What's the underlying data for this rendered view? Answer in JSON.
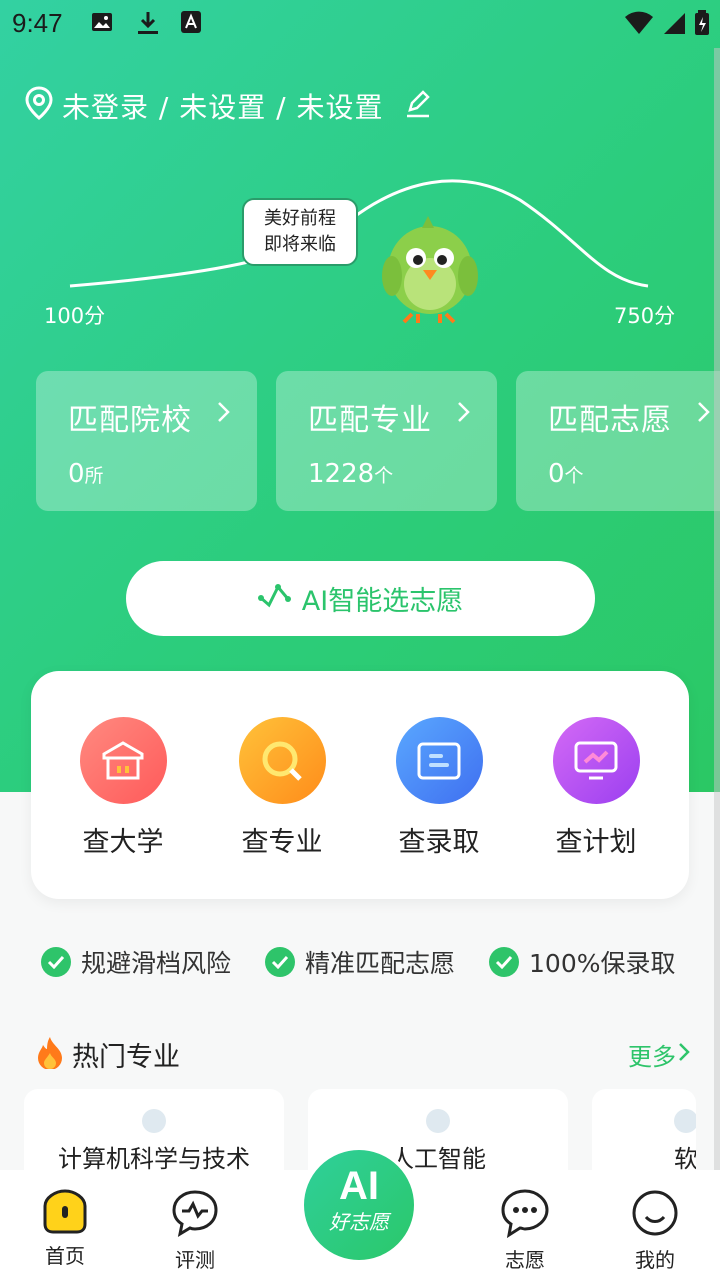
{
  "status_bar": {
    "time": "9:47"
  },
  "location": {
    "text": "未登录 / 未设置 / 未设置"
  },
  "hero": {
    "bubble_line1": "美好前程",
    "bubble_line2": "即将来临",
    "score_min": "100分",
    "score_max": "750分"
  },
  "match_cards": [
    {
      "title": "匹配院校",
      "count": "0",
      "unit": "所"
    },
    {
      "title": "匹配专业",
      "count": "1228",
      "unit": "个"
    },
    {
      "title": "匹配志愿",
      "count": "0",
      "unit": "个"
    }
  ],
  "ai_button": {
    "label": "AI智能选志愿"
  },
  "query_items": [
    {
      "label": "查大学",
      "icon": "university-icon",
      "color": "#ff6e6e"
    },
    {
      "label": "查专业",
      "icon": "search-icon",
      "color": "#ffa726"
    },
    {
      "label": "查录取",
      "icon": "admission-icon",
      "color": "#4f8ef7"
    },
    {
      "label": "查计划",
      "icon": "plan-chart-icon",
      "color": "#b04ff0"
    }
  ],
  "features": [
    "规避滑档风险",
    "精准匹配志愿",
    "100%保录取"
  ],
  "hot_majors": {
    "title": "热门专业",
    "more": "更多",
    "items": [
      "计算机科学与技术",
      "人工智能",
      "软件"
    ]
  },
  "tabbar": {
    "home": "首页",
    "assess": "评测",
    "center_ai": "AI",
    "center_sub": "好志愿",
    "volunteer": "志愿",
    "mine": "我的"
  }
}
